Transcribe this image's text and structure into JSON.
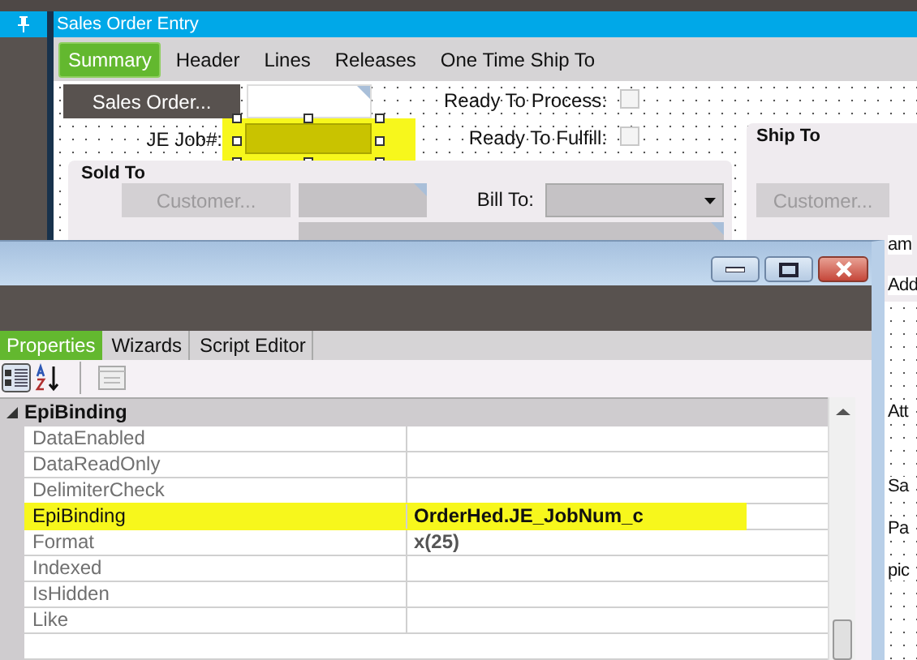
{
  "window": {
    "title": "Sales Order Entry"
  },
  "tabs": [
    {
      "label": "Summary",
      "selected": true
    },
    {
      "label": "Header",
      "selected": false
    },
    {
      "label": "Lines",
      "selected": false
    },
    {
      "label": "Releases",
      "selected": false
    },
    {
      "label": "One Time Ship To",
      "selected": false
    }
  ],
  "form": {
    "sales_order_button": "Sales Order...",
    "job_label": "JE Job#:",
    "job_field": {
      "highlighted": true,
      "selected": true
    },
    "checkboxes": [
      {
        "label": "Ready To Process:",
        "checked": false
      },
      {
        "label": "Ready To Fulfill:",
        "checked": false
      }
    ],
    "sold_to": {
      "title": "Sold To",
      "customer_button": {
        "label": "Customer...",
        "disabled": true
      },
      "bill_to_label": "Bill To:"
    },
    "ship_to": {
      "title": "Ship To",
      "customer_button": {
        "label": "Customer...",
        "disabled": true
      }
    },
    "right_labels": [
      "am",
      "Add",
      "Att",
      "Sa",
      "Pa",
      "pic"
    ]
  },
  "dialog": {
    "tabs": [
      {
        "label": "Properties",
        "selected": true
      },
      {
        "label": "Wizards",
        "selected": false
      },
      {
        "label": "Script Editor",
        "selected": false
      }
    ],
    "grid": {
      "category": "EpiBinding",
      "expanded": true,
      "rows": [
        {
          "name": "DataEnabled",
          "value": "",
          "highlighted": false
        },
        {
          "name": "DataReadOnly",
          "value": "",
          "highlighted": false
        },
        {
          "name": "DelimiterCheck",
          "value": "",
          "highlighted": false
        },
        {
          "name": "EpiBinding",
          "value": "OrderHed.JE_JobNum_c",
          "highlighted": true
        },
        {
          "name": "Format",
          "value": "x(25)",
          "highlighted": false
        },
        {
          "name": "Indexed",
          "value": "",
          "highlighted": false
        },
        {
          "name": "IsHidden",
          "value": "",
          "highlighted": false
        },
        {
          "name": "Like",
          "value": "",
          "highlighted": false
        }
      ]
    }
  }
}
